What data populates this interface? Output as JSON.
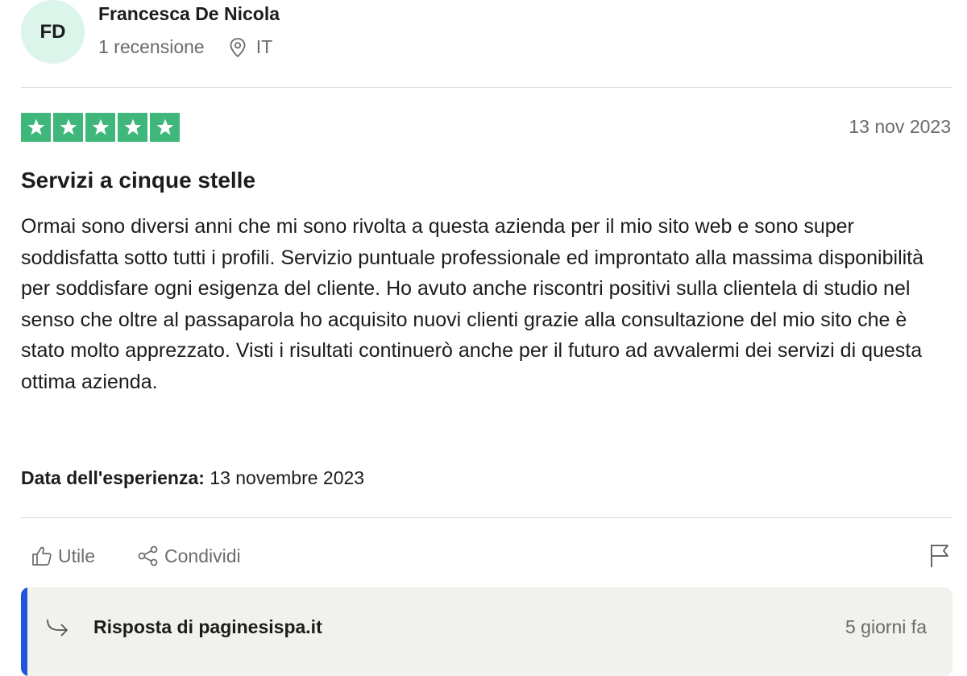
{
  "reviewer": {
    "initials": "FD",
    "name": "Francesca De Nicola",
    "reviews_count": "1 recensione",
    "country": "IT",
    "location_icon": "location-pin-icon"
  },
  "review": {
    "rating": 5,
    "max_rating": 5,
    "star_color": "#3fb77b",
    "date": "13 nov 2023",
    "title": "Servizi a cinque stelle",
    "body": "Ormai sono diversi anni che mi sono rivolta a questa azienda per il mio sito web e sono super soddisfatta sotto tutti i profili. Servizio puntuale professionale ed improntato alla massima disponibilità per soddisfare ogni esigenza del cliente. Ho avuto anche riscontri positivi sulla clientela di studio nel senso che oltre al passaparola ho acquisito nuovi clienti grazie alla consultazione del mio sito che è stato molto apprezzato. Visti i risultati continuerò anche per il futuro ad avvalermi dei servizi di questa ottima azienda.",
    "experience_label": "Data dell'esperienza:",
    "experience_date": "13 novembre 2023"
  },
  "actions": {
    "useful_label": "Utile",
    "useful_icon": "thumbs-up-icon",
    "share_label": "Condividi",
    "share_icon": "share-icon",
    "report_icon": "flag-icon"
  },
  "reply": {
    "title": "Risposta di paginesispa.it",
    "date": "5 giorni fa",
    "icon": "reply-arrow-icon",
    "accent_color": "#1f55d8"
  }
}
